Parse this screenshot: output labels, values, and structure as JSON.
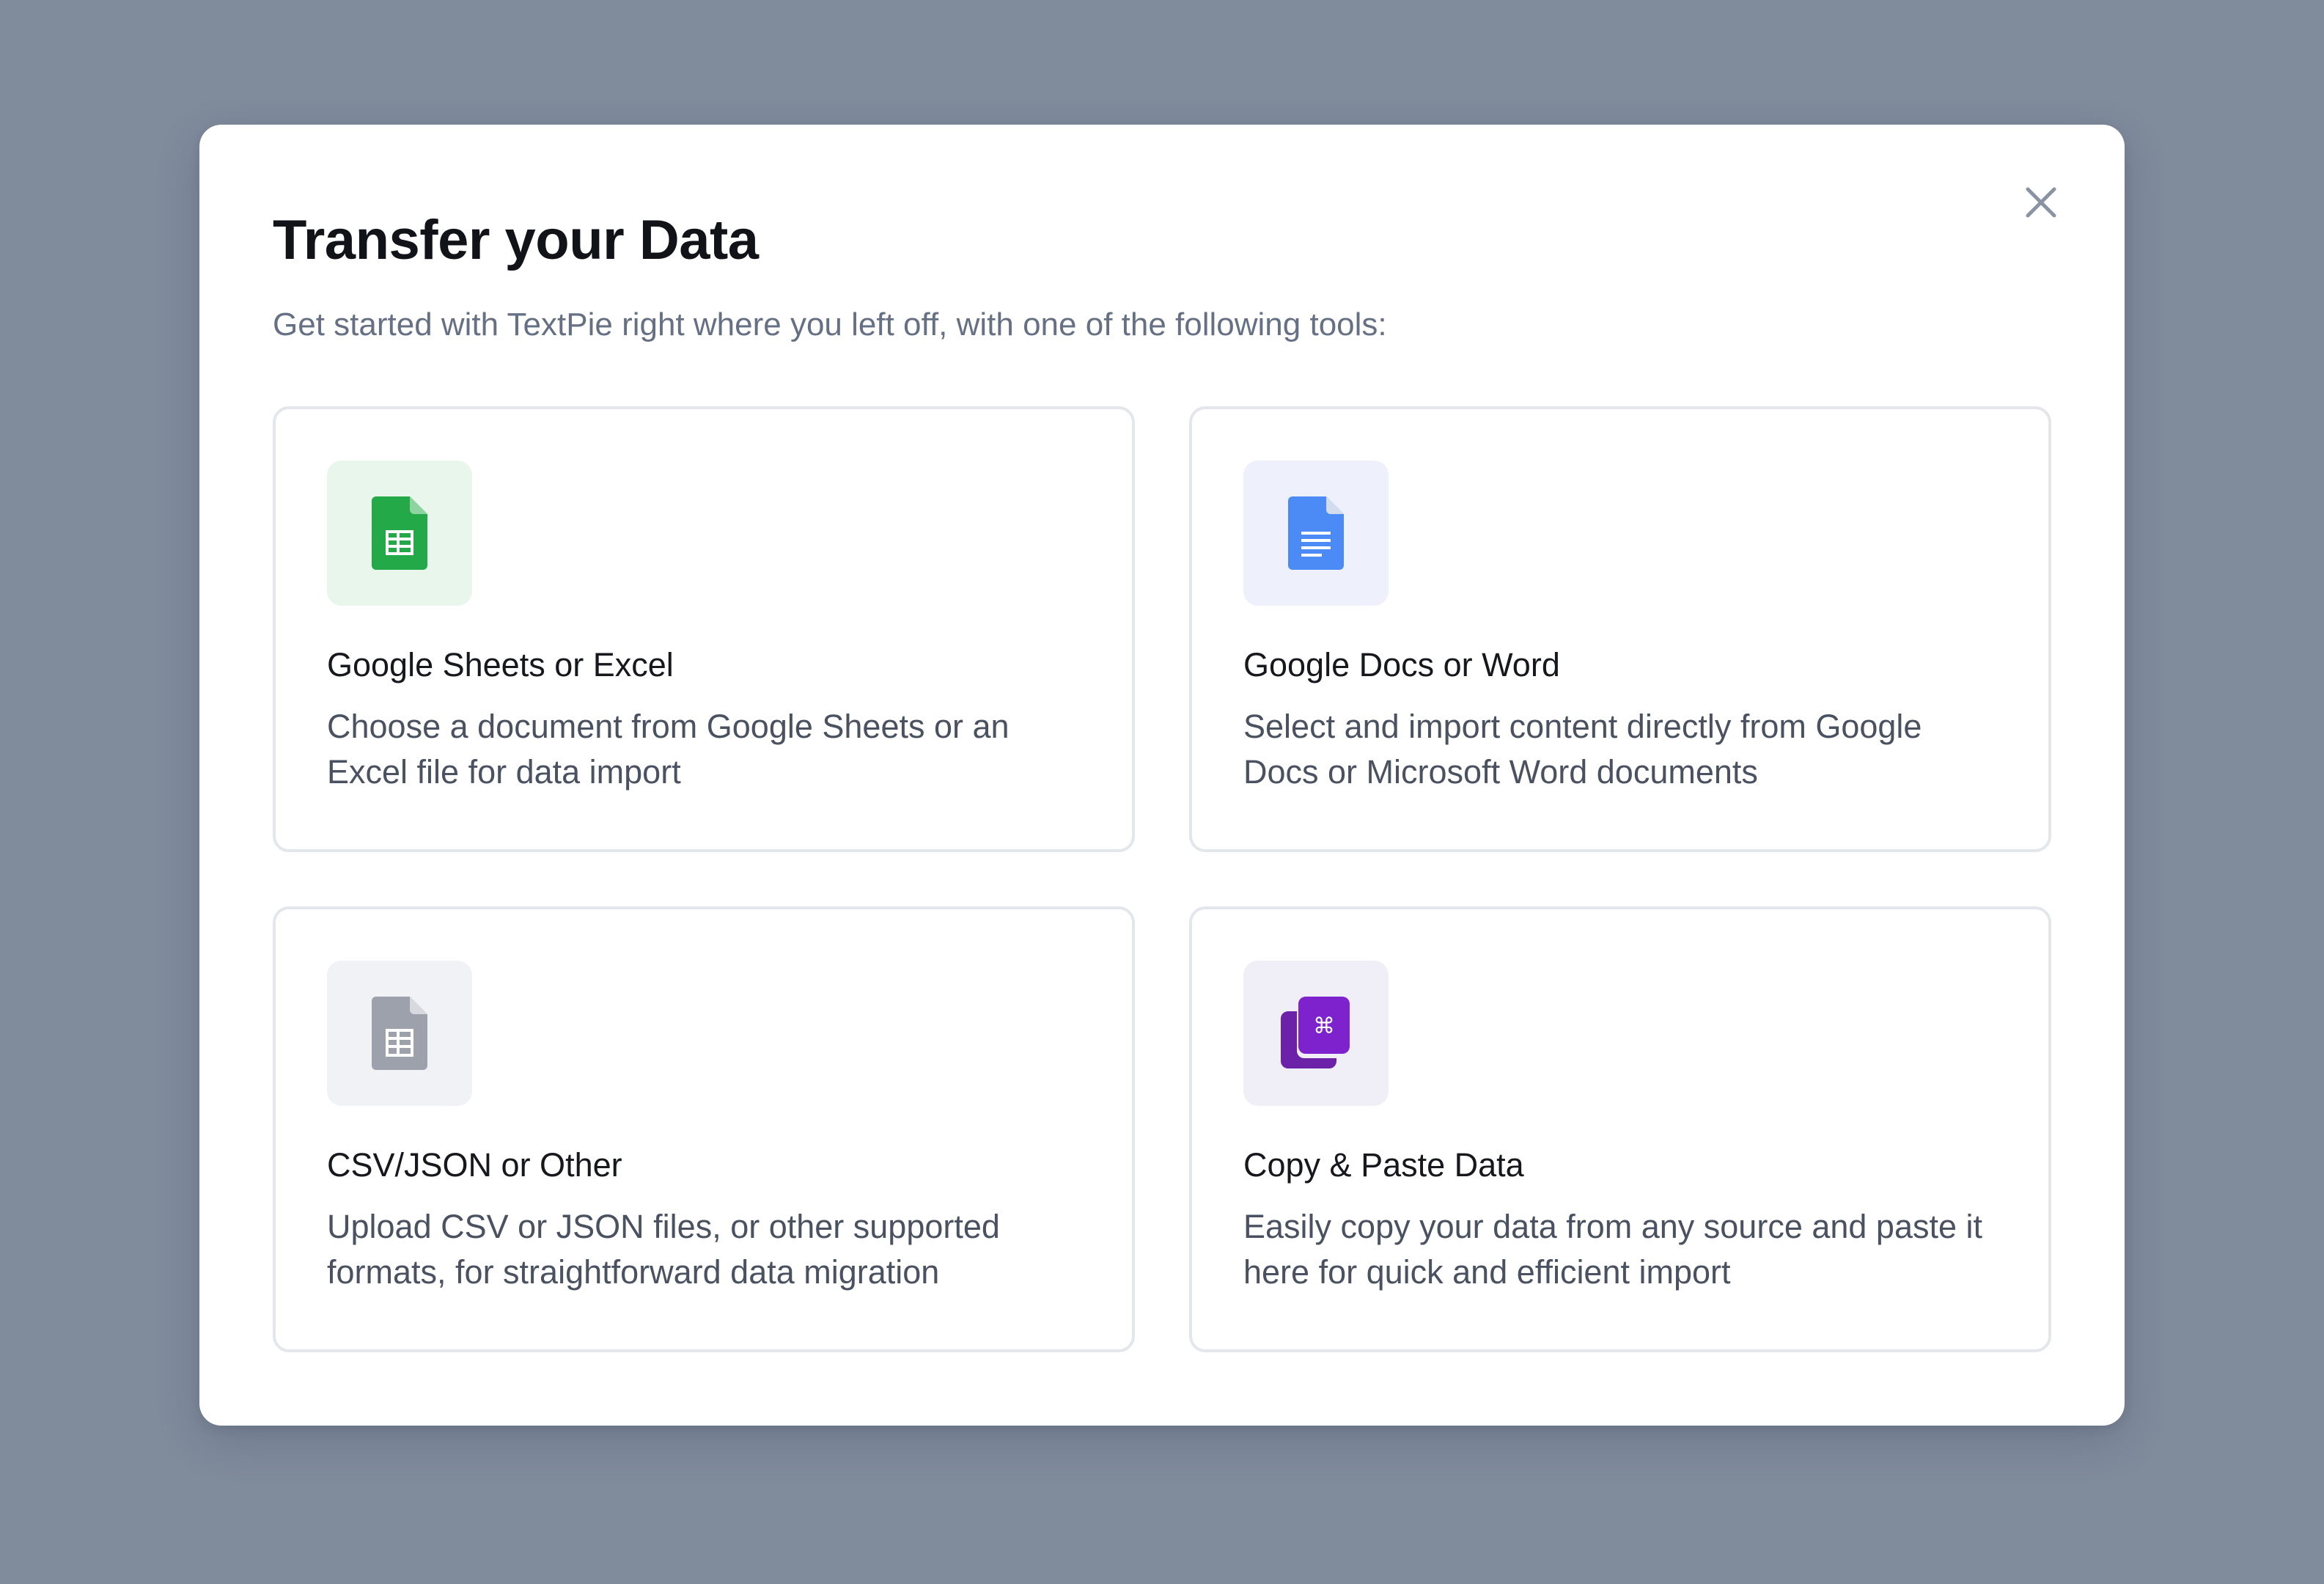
{
  "modal": {
    "title": "Transfer your Data",
    "subtitle": "Get started with TextPie right where you left off, with one of the following tools:",
    "close_icon": "close-icon"
  },
  "options": [
    {
      "title": "Google Sheets or Excel",
      "description": "Choose a document from Google Sheets or an Excel file for data import",
      "icon": "spreadsheet-icon",
      "tile_color": "#e9f6ec",
      "icon_color": "#23a948"
    },
    {
      "title": "Google Docs or Word",
      "description": "Select and import content directly from Google Docs or Microsoft Word documents",
      "icon": "document-icon",
      "tile_color": "#eef0fb",
      "icon_color": "#4c8bf5"
    },
    {
      "title": "CSV/JSON or Other",
      "description": "Upload CSV or JSON files, or other supported formats, for straightforward data migration",
      "icon": "file-table-icon",
      "tile_color": "#f1f2f6",
      "icon_color": "#9ca1ab"
    },
    {
      "title": "Copy & Paste Data",
      "description": "Easily copy your data from any source and paste it here for quick and efficient import",
      "icon": "copy-paste-icon",
      "tile_color": "#f0eff8",
      "icon_color": "#7e22ce"
    }
  ],
  "colors": {
    "backdrop": "#808b9c",
    "card_border": "#e3e6eb",
    "title_text": "#111318",
    "muted_text": "#667085"
  }
}
